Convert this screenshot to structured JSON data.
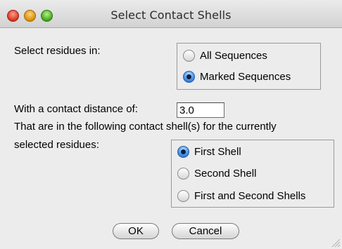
{
  "window": {
    "title": "Select Contact Shells"
  },
  "residues": {
    "label": "Select residues in:",
    "options": [
      {
        "label": "All Sequences",
        "checked": false
      },
      {
        "label": "Marked Sequences",
        "checked": true
      }
    ]
  },
  "distance": {
    "label": "With a contact distance of:",
    "value": "3.0"
  },
  "shells": {
    "line1": "That are in the following contact shell(s) for the currently",
    "line2": "selected residues:",
    "options": [
      {
        "label": "First Shell",
        "checked": true
      },
      {
        "label": "Second Shell",
        "checked": false
      },
      {
        "label": "First and Second Shells",
        "checked": false
      }
    ]
  },
  "buttons": {
    "ok": "OK",
    "cancel": "Cancel"
  },
  "icons": {
    "close": "close-icon",
    "minimize": "minimize-icon",
    "zoom": "zoom-icon",
    "resize": "resize-grip-icon"
  },
  "colors": {
    "radio_selected": "#3f8ee6",
    "close": "#d8331e",
    "minimize": "#d98d0a",
    "zoom": "#3fa51a"
  }
}
